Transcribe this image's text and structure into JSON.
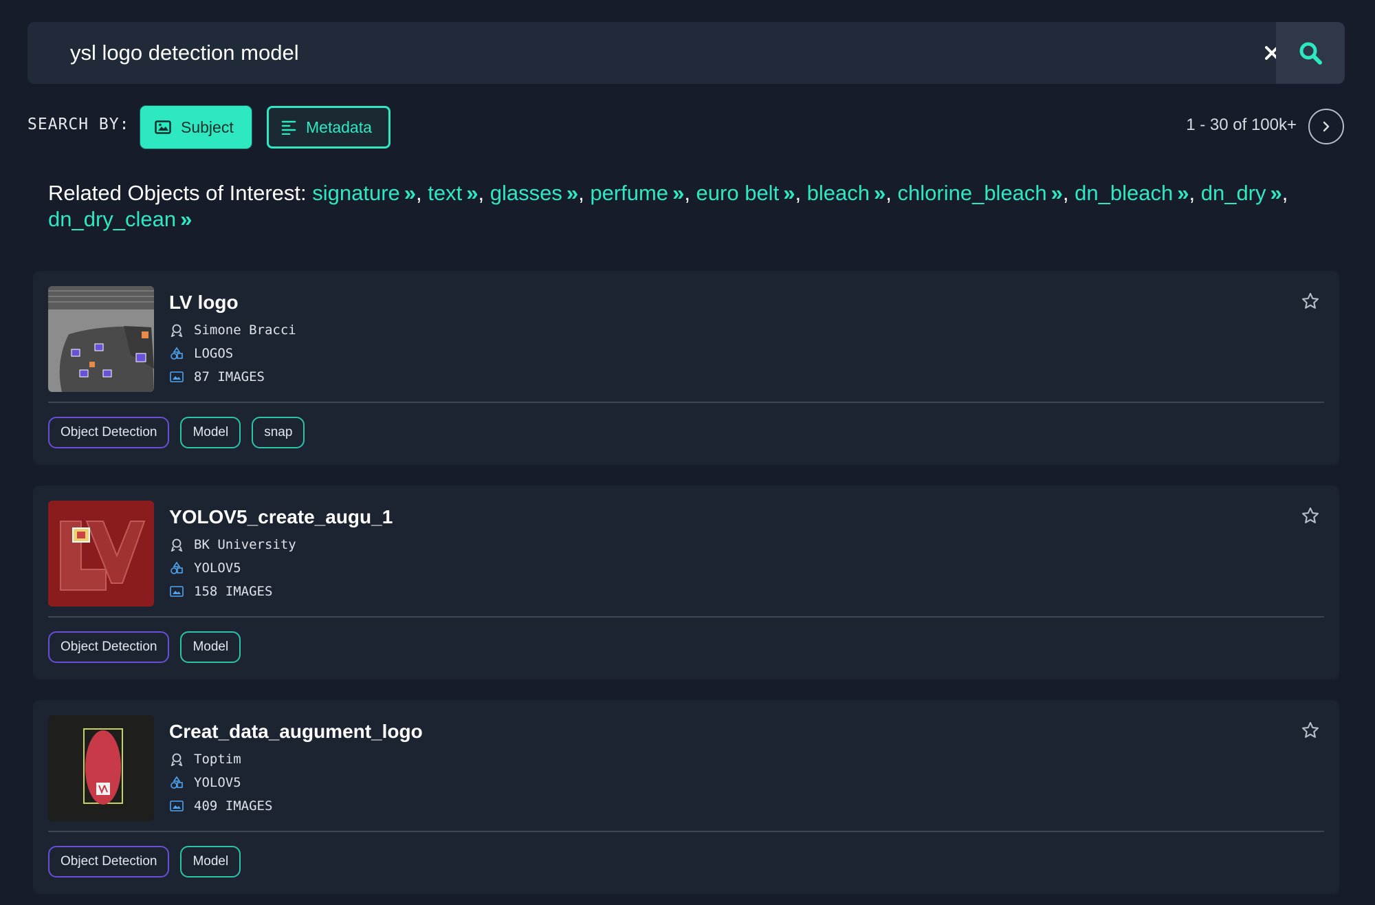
{
  "search": {
    "query": "ysl logo detection model"
  },
  "search_by": {
    "label": "SEARCH BY:",
    "subject": "Subject",
    "metadata": "Metadata"
  },
  "pagination": {
    "text": "1 - 30 of 100k+"
  },
  "related": {
    "label": "Related Objects of Interest:",
    "items": [
      "signature",
      "text",
      "glasses",
      "perfume",
      "euro belt",
      "bleach",
      "chlorine_bleach",
      "dn_bleach",
      "dn_dry",
      "dn_dry_clean"
    ]
  },
  "results": [
    {
      "title": "LV logo",
      "author": "Simone Bracci",
      "category": "LOGOS",
      "images": "87 IMAGES",
      "tags": [
        "Object Detection",
        "Model",
        "snap"
      ]
    },
    {
      "title": "YOLOV5_create_augu_1",
      "author": "BK University",
      "category": "YOLOV5",
      "images": "158 IMAGES",
      "tags": [
        "Object Detection",
        "Model"
      ]
    },
    {
      "title": "Creat_data_augument_logo",
      "author": "Toptim",
      "category": "YOLOV5",
      "images": "409 IMAGES",
      "tags": [
        "Object Detection",
        "Model"
      ]
    }
  ],
  "colors": {
    "accent": "#2ee8c2",
    "background": "#161c2a",
    "card": "#1c2432",
    "tag_purple": "#6a4ed8"
  },
  "icons": [
    "close-icon",
    "search-icon",
    "image-icon",
    "list-icon",
    "chevron-right-icon",
    "double-chevron-icon",
    "author-icon",
    "shapes-icon",
    "images-icon",
    "star-icon"
  ]
}
